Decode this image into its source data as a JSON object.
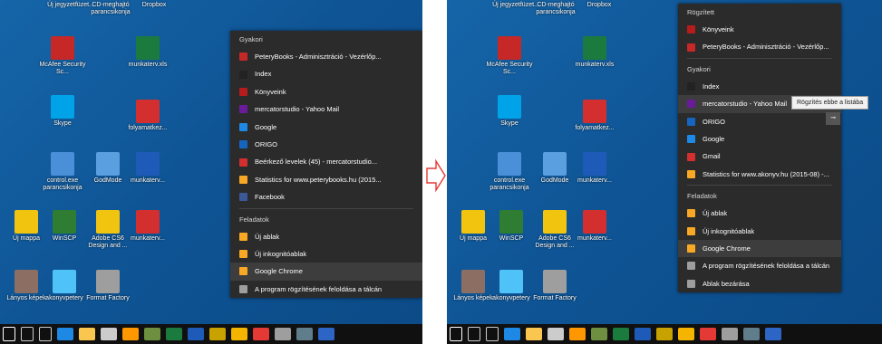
{
  "colors": {
    "desktop": "#1565a8",
    "jumplist_bg": "#2b2b2b",
    "jumplist_hl": "#3d3d3d",
    "taskbar": "#101010",
    "arrow": "#e53935"
  },
  "left": {
    "top_labels": [
      "Új jegyzetfüzet...",
      "CD-meghajtó parancsikonja",
      "Dropbox"
    ],
    "desktop_icons": [
      {
        "label": "McAfee Security Sc...",
        "icon": "mcafee-icon"
      },
      {
        "label": "munkaterv.xls",
        "icon": "excel-icon"
      },
      {
        "label": "Skype",
        "icon": "skype-icon"
      },
      {
        "label": "folyamatkez...",
        "icon": "pdf-icon"
      },
      {
        "label": "control.exe parancsikonja",
        "icon": "control-panel-icon"
      },
      {
        "label": "GodMode",
        "icon": "godmode-icon"
      },
      {
        "label": "munkaterv...",
        "icon": "word-icon"
      },
      {
        "label": "Új mappa",
        "icon": "folder-icon"
      },
      {
        "label": "WinSCP",
        "icon": "winscp-icon"
      },
      {
        "label": "Adobe CS6 Design and ...",
        "icon": "folder-icon"
      },
      {
        "label": "munkaterv...",
        "icon": "pdf-icon"
      },
      {
        "label": "Lányos képek",
        "icon": "photo-icon"
      },
      {
        "label": "akonyvpetery",
        "icon": "network-icon"
      },
      {
        "label": "Format Factory",
        "icon": "formatfactory-icon"
      }
    ],
    "jumplist": {
      "sections": [
        {
          "header": "Gyakori",
          "items": [
            {
              "label": "PeteryBooks - Adminisztráció - Vezérlőp...",
              "color": "#c62828"
            },
            {
              "label": "Index",
              "color": "#222222"
            },
            {
              "label": "Könyveink",
              "color": "#b71c1c"
            },
            {
              "label": "mercatorstudio - Yahoo Mail",
              "color": "#6a1b9a"
            },
            {
              "label": "Google",
              "color": "#1e88e5"
            },
            {
              "label": "ORIGO",
              "color": "#1565c0"
            },
            {
              "label": "Beérkező levelek (45) - mercatorstudio...",
              "color": "#d32f2f"
            },
            {
              "label": "Statistics for www.peterybooks.hu (2015...",
              "color": "#f9a825"
            },
            {
              "label": "Facebook",
              "color": "#3b5998"
            }
          ]
        },
        {
          "header": "Feladatok",
          "items": [
            {
              "label": "Új ablak",
              "color": "#f9a825"
            },
            {
              "label": "Új inkognitóablak",
              "color": "#f9a825"
            },
            {
              "label": "Google Chrome",
              "color": "#f9a825"
            },
            {
              "label": "A program rögzítésének feloldása a tálcán",
              "color": "#9e9e9e"
            }
          ]
        }
      ]
    }
  },
  "right": {
    "jumplist": {
      "sections": [
        {
          "header": "Rögzített",
          "items": [
            {
              "label": "Könyveink",
              "color": "#b71c1c"
            },
            {
              "label": "PeteryBooks - Adminisztráció - Vezérlőp...",
              "color": "#c62828"
            }
          ]
        },
        {
          "header": "Gyakori",
          "items": [
            {
              "label": "Index",
              "color": "#222222"
            },
            {
              "label": "mercatorstudio - Yahoo Mail",
              "color": "#6a1b9a"
            },
            {
              "label": "ORIGO",
              "color": "#1565c0"
            },
            {
              "label": "Google",
              "color": "#1e88e5"
            },
            {
              "label": "Gmail",
              "color": "#d32f2f"
            },
            {
              "label": "Statistics for www.akonyv.hu (2015-08) -...",
              "color": "#f9a825"
            }
          ]
        },
        {
          "header": "Feladatok",
          "items": [
            {
              "label": "Új ablak",
              "color": "#f9a825"
            },
            {
              "label": "Új inkognitóablak",
              "color": "#f9a825"
            },
            {
              "label": "Google Chrome",
              "color": "#f9a825"
            },
            {
              "label": "A program rögzítésének feloldása a tálcán",
              "color": "#9e9e9e"
            },
            {
              "label": "Ablak bezárása",
              "color": "#9e9e9e"
            }
          ]
        }
      ]
    },
    "tooltip": "Rögzítés ebbe a listába",
    "pin_button": "⊸"
  },
  "taskbar": {
    "icons": [
      "windows-start-icon",
      "search-icon",
      "task-view-icon",
      "edge-icon",
      "file-explorer-icon",
      "store-icon",
      "outlook-icon",
      "app-icon",
      "excel-icon",
      "word-icon",
      "pencil-icon",
      "chrome-icon",
      "opera-icon",
      "tools-icon",
      "settings-icon",
      "photoshop-icon"
    ],
    "colors": [
      "#ffffff",
      "#cccccc",
      "#cccccc",
      "#1e88e5",
      "#f9c74f",
      "#cccccc",
      "#ff9800",
      "#6d8f3f",
      "#1b7a3d",
      "#1e5bb8",
      "#c8a200",
      "#f4b400",
      "#e53935",
      "#9e9e9e",
      "#607d8b",
      "#2d65c7"
    ]
  }
}
